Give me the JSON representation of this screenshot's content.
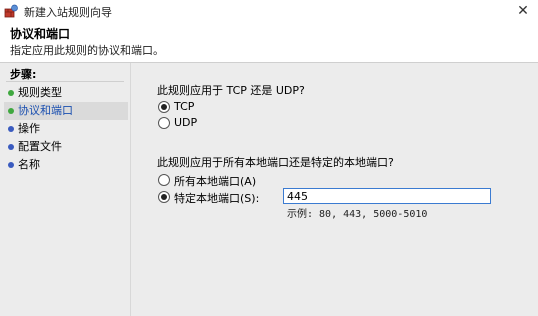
{
  "window": {
    "title": "新建入站规则向导",
    "close_glyph": "✕",
    "icon": "firewall-rule-icon"
  },
  "header": {
    "title": "协议和端口",
    "subtitle": "指定应用此规则的协议和端口。"
  },
  "sidebar": {
    "steps_label": "步骤:",
    "steps": [
      {
        "label": "规则类型",
        "state": "done"
      },
      {
        "label": "协议和端口",
        "state": "current"
      },
      {
        "label": "操作",
        "state": "pending"
      },
      {
        "label": "配置文件",
        "state": "pending"
      },
      {
        "label": "名称",
        "state": "pending"
      }
    ]
  },
  "main": {
    "protocol_question": "此规则应用于 TCP 还是 UDP?",
    "protocol_options": [
      {
        "label": "TCP",
        "checked": true
      },
      {
        "label": "UDP",
        "checked": false
      }
    ],
    "port_question": "此规则应用于所有本地端口还是特定的本地端口?",
    "port_options": [
      {
        "label": "所有本地端口(A)",
        "checked": false
      },
      {
        "label": "特定本地端口(S):",
        "checked": true
      }
    ],
    "port_value": "445",
    "port_example": "示例: 80, 443, 5000-5010"
  },
  "colors": {
    "done_dot": "#3fa83f",
    "pending_dot": "#3a5bbf",
    "current_text": "#1a4fb0",
    "input_border": "#3b7bd1"
  }
}
